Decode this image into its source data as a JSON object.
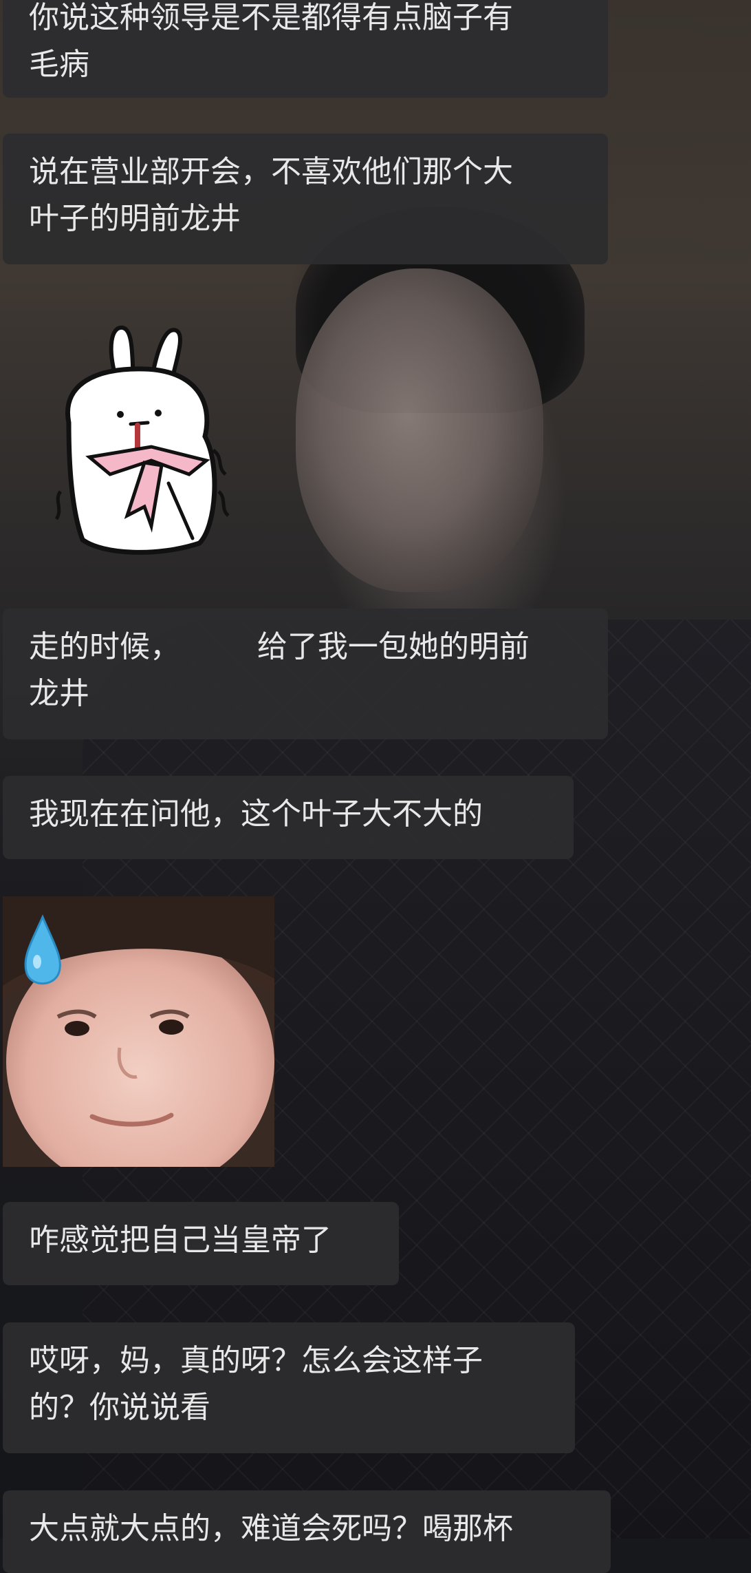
{
  "messages": [
    {
      "text": "你说这种领导是不是都得有点脑子有\n毛病"
    },
    {
      "text": "说在营业部开会，不喜欢他们那个大\n叶子的明前龙井"
    },
    {
      "text": "走的时候，        给了我一包她的明前\n龙井"
    },
    {
      "text": "我现在在问他，这个叶子大不大的"
    },
    {
      "text": "咋感觉把自己当皇帝了"
    },
    {
      "text": "哎呀，妈，真的呀？怎么会这样子\n的？你说说看"
    },
    {
      "text": "大点就大点的，难道会死吗？喝那杯"
    }
  ],
  "stickers": {
    "rabbit": "rabbit-sticker",
    "girl": "crying-girl-sticker"
  },
  "colors": {
    "bubble": "#2c2c2e",
    "text": "#e8e8e8"
  }
}
